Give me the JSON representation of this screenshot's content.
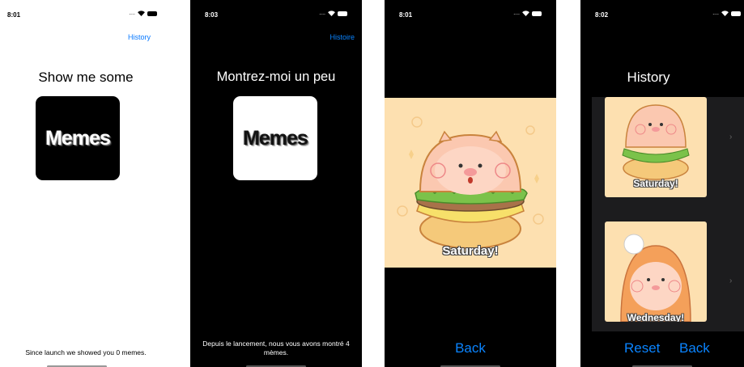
{
  "screens": {
    "home_en": {
      "time": "8:01",
      "nav_link": "History",
      "headline": "Show me some",
      "tile_text": "Memes",
      "counter": "Since launch we showed you 0 memes."
    },
    "home_fr": {
      "time": "8:03",
      "nav_link": "Histoire",
      "headline": "Montrez-moi un peu",
      "tile_text": "Memes",
      "counter": "Depuis le lancement, nous vous avons montré 4 mèmes."
    },
    "detail": {
      "time": "8:01",
      "caption": "Saturday!",
      "back_label": "Back"
    },
    "history": {
      "time": "8:02",
      "title": "History",
      "items": [
        {
          "caption": "Saturday!"
        },
        {
          "caption": "Wednesday!"
        }
      ],
      "reset_label": "Reset",
      "back_label": "Back"
    }
  },
  "status": {
    "dots": "...."
  },
  "colors": {
    "accent": "#0a84ff",
    "meme_bg": "#fde0b0"
  },
  "icons": [
    "wifi-icon",
    "battery-icon",
    "chevron-right-icon",
    "pig-burger-illustration"
  ]
}
